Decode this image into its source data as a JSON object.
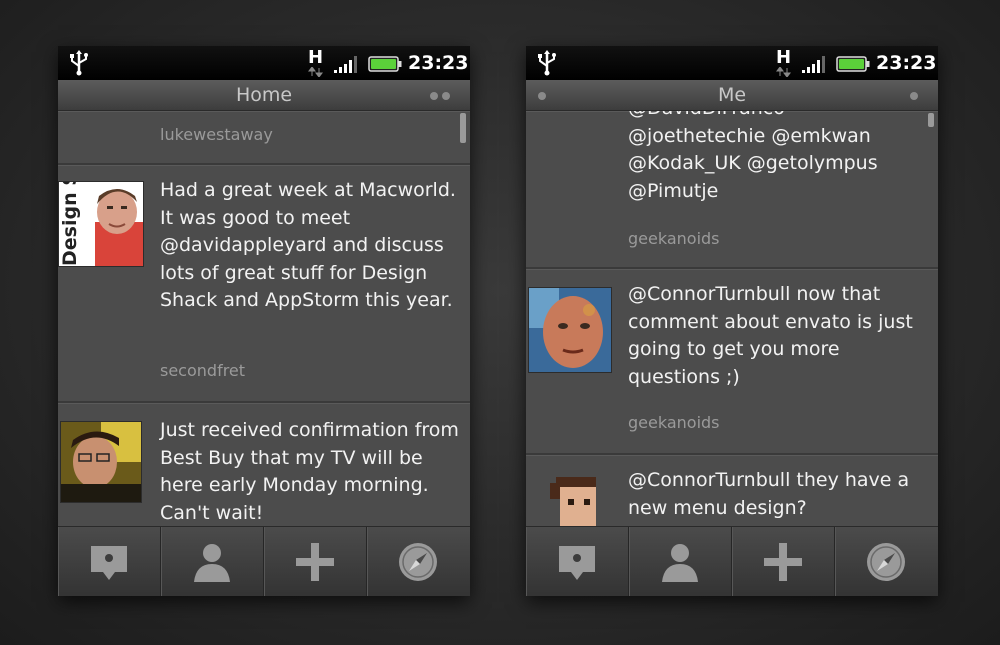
{
  "status_bar": {
    "network": "H",
    "time": "23:23"
  },
  "left_screen": {
    "title": "Home",
    "tweets": [
      {
        "text": "",
        "user": "lukewestaway"
      },
      {
        "text": "Had a great week at Macworld. It was good to meet @davidappleyard and discuss lots of great stuff for Design Shack and AppStorm this year.",
        "user": "secondfret",
        "avatar_text": "Design Shack"
      },
      {
        "text": "Just received confirmation from Best Buy that my TV will be here early Monday morning. Can't wait!",
        "user": ""
      }
    ]
  },
  "right_screen": {
    "title": "Me",
    "tweets": [
      {
        "text": "@DavidDiFranco @joethetechie @emkwan @Kodak_UK @getolympus @Pimutje",
        "user": "geekanoids"
      },
      {
        "text": "@ConnorTurnbull now that comment about envato is just going to get you more questions ;)",
        "user": "geekanoids"
      },
      {
        "text": "@ConnorTurnbull they have a new menu design?",
        "user": ""
      }
    ]
  },
  "bottom_bar": {
    "icons": [
      "tweet-icon",
      "profile-icon",
      "add-icon",
      "compass-icon"
    ]
  },
  "colors": {
    "background": "#2a2a2a",
    "screen": "#4c4c4c",
    "battery": "#5bd13a",
    "tweet_text": "#f2f2f2",
    "username": "#9a9a9a"
  }
}
